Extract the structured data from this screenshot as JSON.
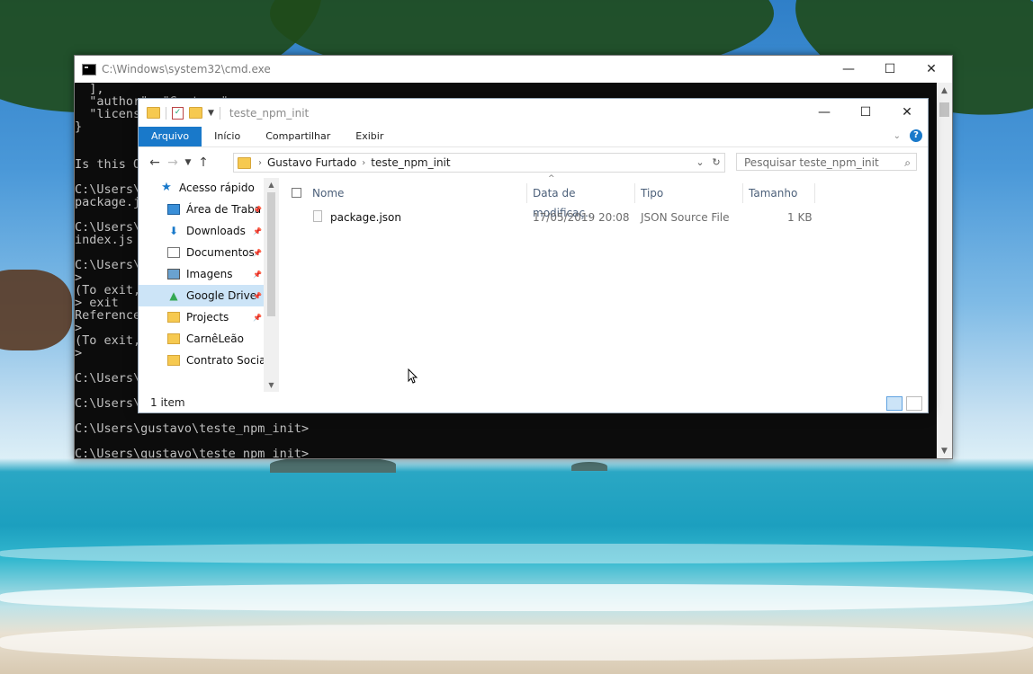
{
  "cmd": {
    "title": "C:\\Windows\\system32\\cmd.exe",
    "lines": [
      "  ],",
      "  \"author\": \"Gustavo\",",
      "  \"license\": \"ISC\"",
      "}",
      "",
      "",
      "Is this OK? (yes)",
      "",
      "C:\\Users\\gustavo\\teste_npm_init>",
      "package.json",
      "",
      "C:\\Users\\gustavo\\teste_npm_init>",
      "index.js",
      "",
      "C:\\Users\\gustavo\\teste_npm_init>",
      ">",
      "(To exit, press ^C again or type .exit)",
      "> exit",
      "ReferenceError: exit is not defined",
      ">",
      "(To exit, press ^C again or type .exit)",
      ">",
      "",
      "C:\\Users\\gustavo\\teste_npm_init>",
      "",
      "C:\\Users\\gustavo\\teste_npm_init>",
      "",
      "C:\\Users\\gustavo\\teste_npm_init>",
      "",
      "C:\\Users\\gustavo\\teste_npm_init>"
    ],
    "minimize": "—",
    "maximize": "☐",
    "close": "✕"
  },
  "explorer": {
    "title": "teste_npm_init",
    "ribbon_tabs": [
      "Arquivo",
      "Início",
      "Compartilhar",
      "Exibir"
    ],
    "breadcrumb": [
      "Gustavo Furtado",
      "teste_npm_init"
    ],
    "search_placeholder": "Pesquisar teste_npm_init",
    "nav_items": [
      {
        "label": "Acesso rápido",
        "icon": "star-icon"
      },
      {
        "label": "Área de Traba",
        "icon": "desktop-icon"
      },
      {
        "label": "Downloads",
        "icon": "download-icon"
      },
      {
        "label": "Documentos",
        "icon": "document-icon"
      },
      {
        "label": "Imagens",
        "icon": "image-icon"
      },
      {
        "label": "Google Drive",
        "icon": "google-drive-icon"
      },
      {
        "label": "Projects",
        "icon": "folder-icon"
      },
      {
        "label": "CarnêLeão",
        "icon": "folder-icon"
      },
      {
        "label": "Contrato Social",
        "icon": "contact-folder-icon"
      }
    ],
    "columns": [
      "Nome",
      "Data de modificaç...",
      "Tipo",
      "Tamanho"
    ],
    "files": [
      {
        "name": "package.json",
        "modified": "17/05/2019 20:08",
        "type": "JSON Source File",
        "size": "1 KB"
      }
    ],
    "status": "1 item"
  },
  "colors": {
    "accent": "#1979ca",
    "selection": "#cce4f7"
  }
}
